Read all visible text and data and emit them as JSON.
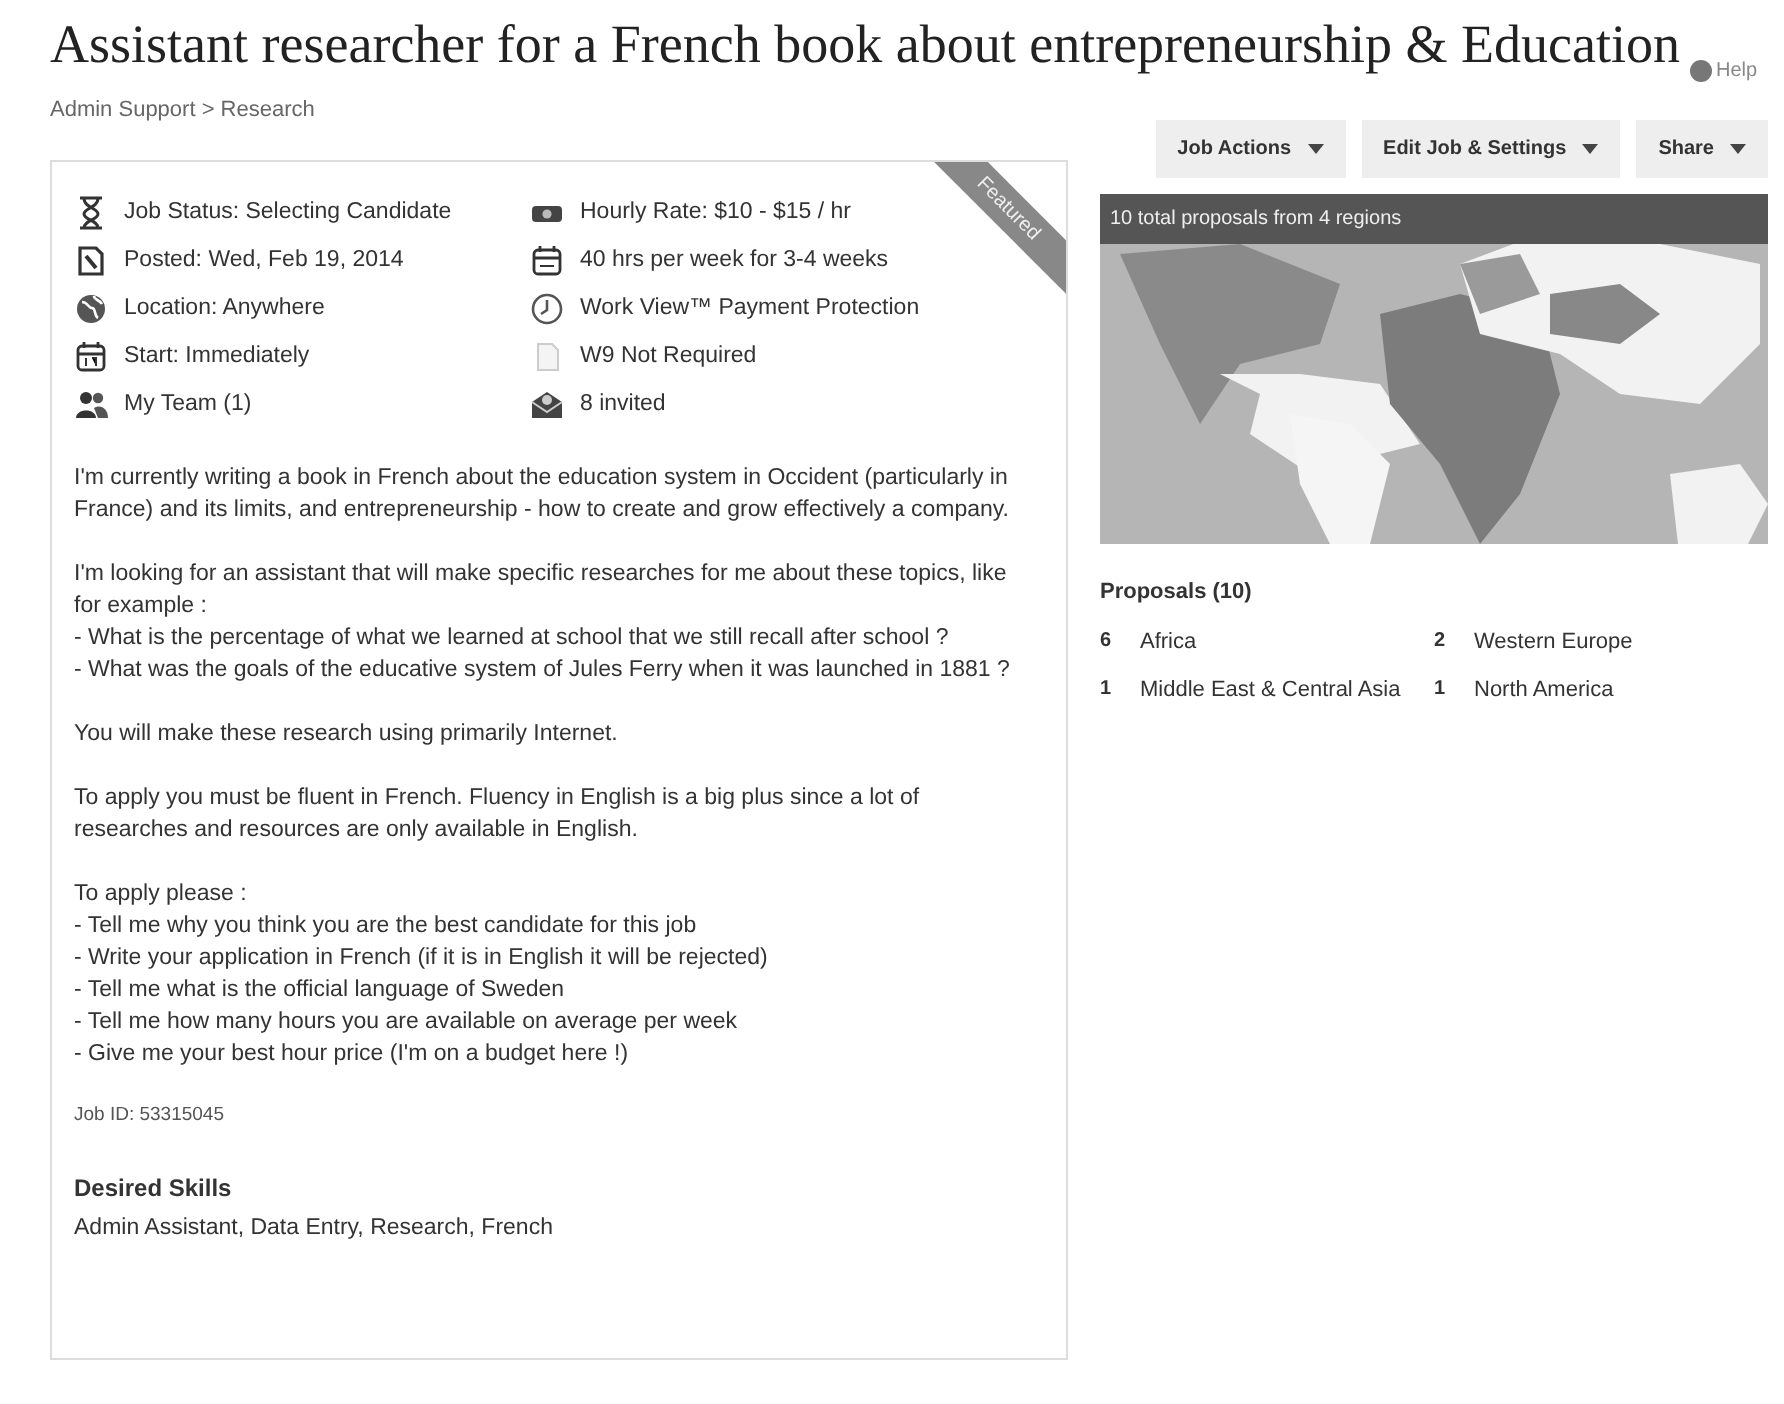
{
  "title": "Assistant researcher for a French book about entrepreneurship & Education",
  "help": "Help",
  "breadcrumb": "Admin Support > Research",
  "ribbon": "Featured",
  "meta_left": [
    {
      "text": "Job Status: Selecting Candidate"
    },
    {
      "text": "Posted: Wed, Feb 19, 2014"
    },
    {
      "text": "Location: Anywhere"
    },
    {
      "text": "Start: Immediately"
    },
    {
      "text": "My Team (1)"
    }
  ],
  "meta_right": [
    {
      "text": "Hourly Rate: $10 - $15 / hr"
    },
    {
      "text": "40 hrs per week for 3-4 weeks"
    },
    {
      "text": "Work View™ Payment Protection"
    },
    {
      "text": "W9 Not Required"
    },
    {
      "text": "8 invited"
    }
  ],
  "description": [
    "I'm currently writing a book in French about the education system in Occident (particularly in France) and its limits, and entrepreneurship - how to create and grow effectively a company.",
    "I'm looking for an assistant that will make specific researches for me about these topics, like for example :\n- What is the percentage of what we learned at school that we still recall after school ?\n- What was the goals of the educative system of Jules Ferry when it was launched in 1881 ?",
    "You will make these research using primarily Internet.",
    "To apply you must be fluent in French. Fluency in English is a big plus since a lot of researches and resources are only available in English.",
    "To apply please :\n- Tell me why you think you are the best candidate for this job\n- Write your application in French (if it is in English it will be rejected)\n- Tell me what is the official language of Sweden\n- Tell me how many hours you are available on average per week\n- Give me your best hour price (I'm on a budget here !)"
  ],
  "job_id": "Job ID: 53315045",
  "skills": {
    "heading": "Desired Skills",
    "text": "Admin Assistant, Data Entry, Research, French"
  },
  "actions": [
    "Job Actions",
    "Edit Job & Settings",
    "Share"
  ],
  "map": {
    "kind": "picture",
    "caption": "10 total proposals from 4 regions"
  },
  "proposals": {
    "heading": "Proposals (10)",
    "regions": [
      {
        "count": "6",
        "name": "Africa"
      },
      {
        "count": "2",
        "name": "Western Europe"
      },
      {
        "count": "1",
        "name": "Middle East & Central Asia"
      },
      {
        "count": "1",
        "name": "North America"
      }
    ]
  }
}
